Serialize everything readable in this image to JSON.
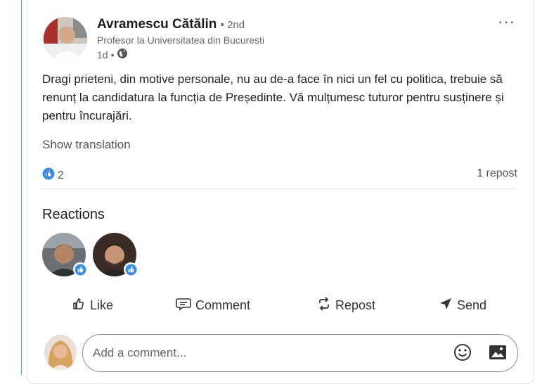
{
  "post": {
    "author_name": "Avramescu Cătălin",
    "connection_degree": "• 2nd",
    "author_title": "Profesor la Universitatea din Bucuresti",
    "time_ago": "1d",
    "time_separator": "•",
    "visibility_icon": "globe-icon",
    "more_label": "···",
    "body": "Dragi prieteni, din motive personale, nu au de-a face în nici un fel cu politica, trebuie să renunț la candidatura la funcția de Președinte. Vă mulțumesc tuturor pentru susținere și pentru încurajări.",
    "show_translation": "Show translation"
  },
  "social": {
    "reaction_icon": "like-reaction-icon",
    "reaction_count": "2",
    "repost_count": "1 repost"
  },
  "reactions": {
    "heading": "Reactions",
    "people": [
      {
        "avatar": "reactor-avatar",
        "badge": "like-badge-icon"
      },
      {
        "avatar": "reactor-avatar",
        "badge": "like-badge-icon"
      }
    ]
  },
  "actions": {
    "like": "Like",
    "comment": "Comment",
    "repost": "Repost",
    "send": "Send"
  },
  "comment_box": {
    "placeholder": "Add a comment...",
    "emoji_icon": "emoji-icon",
    "image_icon": "image-icon"
  },
  "colors": {
    "accent": "#0a66c2",
    "frame_rule": "#6aa3e6"
  }
}
